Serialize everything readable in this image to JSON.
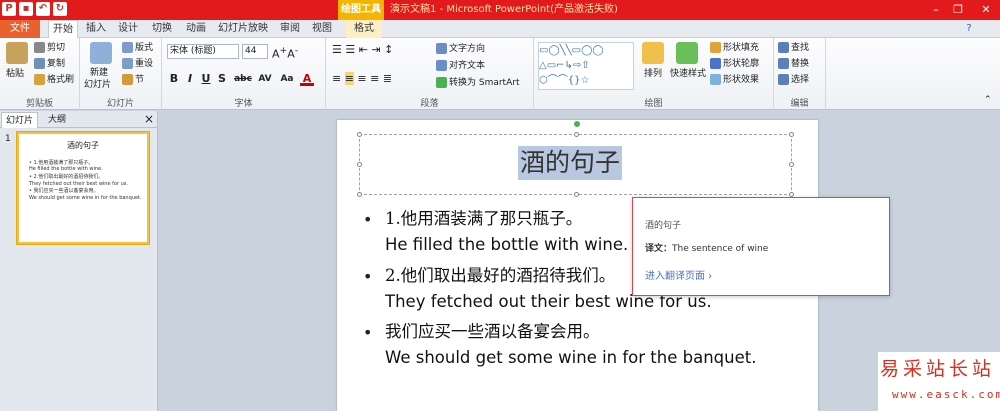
{
  "window": {
    "title": "演示文稿1 - Microsoft PowerPoint(产品激活失败)",
    "contextual_tool": "绘图工具",
    "controls": [
      "–",
      "❐",
      "✕"
    ]
  },
  "tabs": [
    "文件",
    "开始",
    "插入",
    "设计",
    "切换",
    "动画",
    "幻灯片放映",
    "审阅",
    "视图",
    "格式"
  ],
  "ribbon": {
    "clipboard": {
      "paste": "粘贴",
      "cut": "剪切",
      "copy": "复制",
      "format_painter": "格式刷",
      "label": "剪贴板"
    },
    "slides": {
      "new_slide": "新建",
      "new_slide2": "幻灯片",
      "layout": "版式",
      "reset": "重设",
      "section": "节",
      "label": "幻灯片"
    },
    "font": {
      "name": "宋体 (标题)",
      "size": "44",
      "label": "字体"
    },
    "paragraph": {
      "text_direction": "文字方向",
      "align_text": "对齐文本",
      "smartart": "转换为 SmartArt",
      "label": "段落"
    },
    "drawing": {
      "arrange": "排列",
      "quick_styles": "快速样式",
      "fill": "形状填充",
      "outline": "形状轮廓",
      "effects": "形状效果",
      "label": "绘图"
    },
    "editing": {
      "find": "查找",
      "replace": "替换",
      "select": "选择",
      "label": "编辑"
    }
  },
  "panel": {
    "tab_slides": "幻灯片",
    "tab_outline": "大纲",
    "close": "×",
    "slide_number": "1"
  },
  "thumbnail": {
    "title": "酒的句子",
    "lines": [
      "• 1.他用酒装满了那只瓶子。",
      "He filled the bottle with wine.",
      "• 2.他们取出最好的酒招待我们。",
      "They fetched out their best wine for us.",
      "• 我们应买一些酒以备宴会用。",
      "We should get some wine in for the banquet."
    ]
  },
  "slide": {
    "title": "酒的句子",
    "items": [
      {
        "zh": "1.他用酒装满了那只瓶子。",
        "en": "He filled the bottle with wine."
      },
      {
        "zh": "2.他们取出最好的酒招待我们。",
        "en": "They fetched out their best wine for us."
      },
      {
        "zh": "我们应买一些酒以备宴会用。",
        "en": "We should get some wine in for the banquet."
      }
    ]
  },
  "popup": {
    "source": "酒的句子",
    "translation_label": "译文：",
    "translation": "The sentence of wine",
    "link": "进入翻译页面 ›"
  },
  "watermark": {
    "line1": "易采站长站",
    "line2": "www.easck.com"
  }
}
